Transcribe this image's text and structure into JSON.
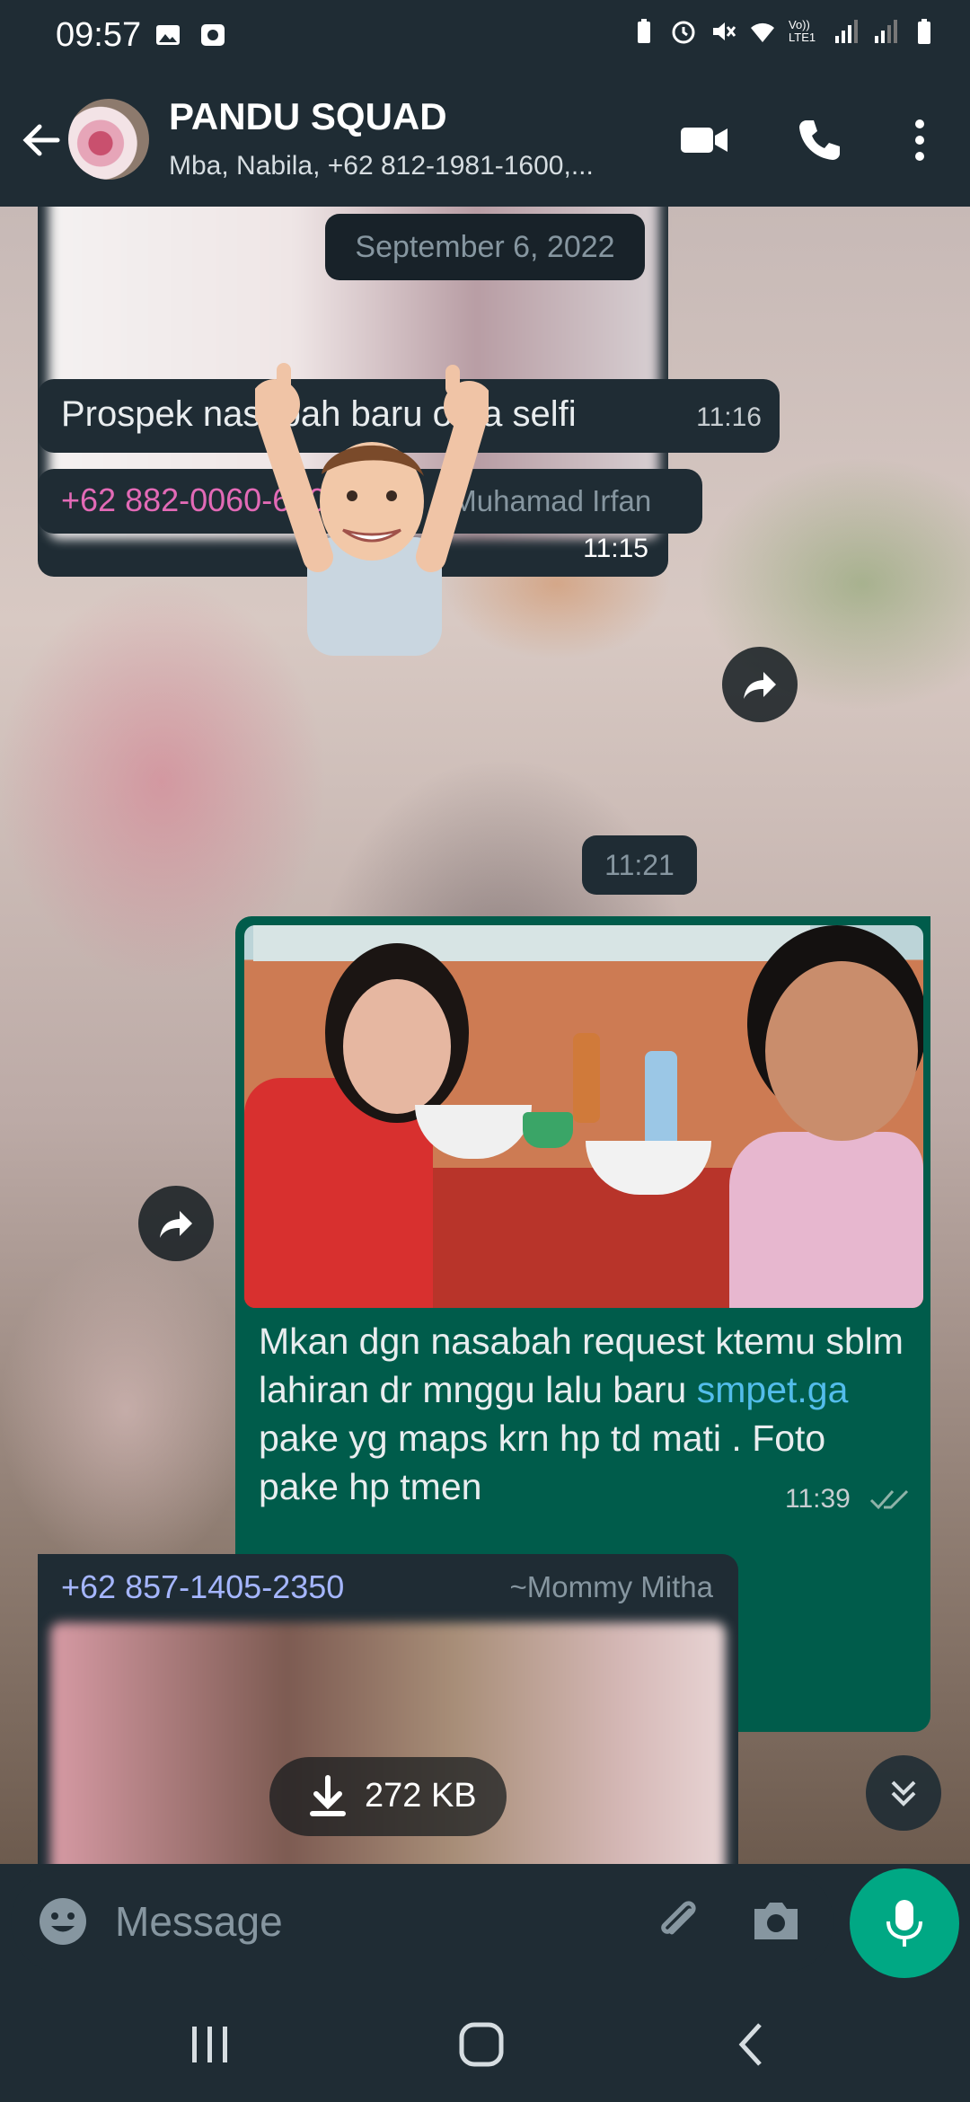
{
  "status_bar": {
    "time": "09:57",
    "signal_label": "Vo)) LTE1"
  },
  "header": {
    "title": "PANDU SQUAD",
    "subtitle": "Mba, Nabila, +62 812-1981-1600,...",
    "icons": [
      "back-arrow-icon",
      "video-call-icon",
      "voice-call-icon",
      "more-vert-icon"
    ]
  },
  "chat": {
    "date_chip": "September 6, 2022",
    "messages": [
      {
        "type": "image",
        "time": "11:15"
      },
      {
        "type": "text",
        "text": "Prospek nasabah baru oma selfi",
        "time": "11:16"
      },
      {
        "type": "sticker",
        "sender_number": "+62 882-0060-62020",
        "sender_name": "~Muhamad Irfan",
        "time": "11:21"
      },
      {
        "type": "image_caption",
        "text_before": "Mkan dgn nasabah request ktemu sblm lahiran dr mnggu lalu baru ",
        "link": "smpet.ga",
        "text_after": " pake yg maps krn hp td mati . Foto pake hp tmen",
        "time": "11:39"
      },
      {
        "type": "image_download",
        "sender_number": "+62 857-1405-2350",
        "sender_name": "~Mommy Mitha",
        "size": "272 KB"
      }
    ]
  },
  "input": {
    "placeholder": "Message"
  },
  "colors": {
    "app_bar": "#1f2c34",
    "incoming_bubble": "#1f2c34",
    "outgoing_bubble": "#005c4b",
    "accent": "#00a884",
    "link": "#53bdeb",
    "sender1": "#e26ab6",
    "sender2": "#a5b6ff"
  }
}
